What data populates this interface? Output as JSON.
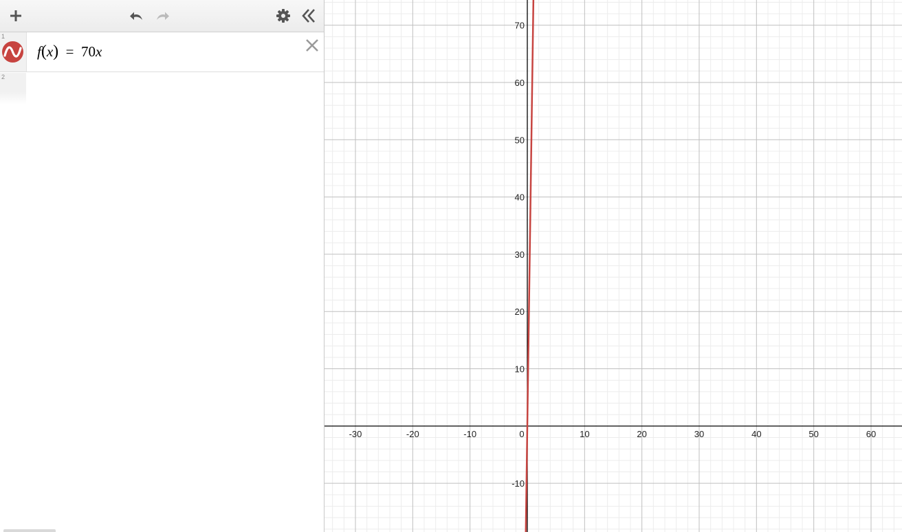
{
  "toolbar": {
    "add_icon": "plus-icon",
    "undo_icon": "undo-icon",
    "redo_icon": "redo-icon",
    "settings_icon": "gear-icon",
    "collapse_icon": "double-chevron-left-icon"
  },
  "expressions": [
    {
      "index": "1",
      "name": "f",
      "variable": "x",
      "equals": "=",
      "rhs_coefficient": "70",
      "rhs_variable": "x",
      "color": "#c74440",
      "delete_icon": "close-icon"
    },
    {
      "index": "2"
    }
  ],
  "colors": {
    "curve": "#c74440",
    "toolbar_icon": "#555555",
    "disabled_icon": "#bbbbbb",
    "grid_minor": "#ececec",
    "grid_major": "#bfbfbf",
    "axis": "#000000"
  },
  "graph": {
    "xlim": [
      -35.4,
      65.4
    ],
    "ylim": [
      -18.5,
      74.4
    ],
    "major_step": 10,
    "minor_step": 2,
    "x_tick_labels": [
      "-30",
      "-20",
      "-10",
      "0",
      "10",
      "20",
      "30",
      "40",
      "50",
      "60"
    ],
    "x_tick_values": [
      -30,
      -20,
      -10,
      0,
      10,
      20,
      30,
      40,
      50,
      60
    ],
    "y_tick_labels": [
      "-10",
      "10",
      "20",
      "30",
      "40",
      "50",
      "60",
      "70"
    ],
    "y_tick_values": [
      -10,
      10,
      20,
      30,
      40,
      50,
      60,
      70
    ],
    "function_slope": 70
  }
}
